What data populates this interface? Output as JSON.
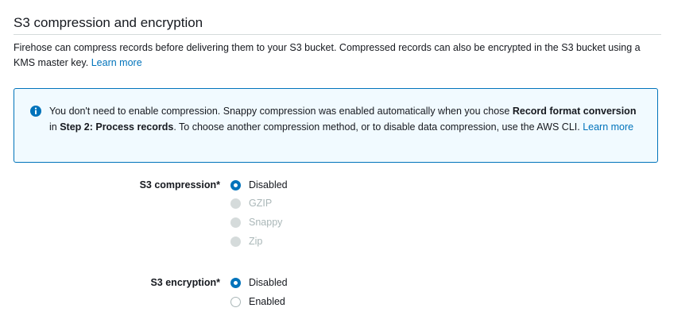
{
  "section": {
    "title": "S3 compression and encryption",
    "description": "Firehose can compress records before delivering them to your S3 bucket. Compressed records can also be encrypted in the S3 bucket using a KMS master key.",
    "learn_more": "Learn more"
  },
  "info": {
    "icon": "info-icon",
    "text_1": "You don't need to enable compression. Snappy compression was enabled automatically when you chose ",
    "bold_1": "Record format conversion",
    "text_2": " in ",
    "bold_2": "Step 2: Process records",
    "text_3": ". To choose another compression method, or to disable data compression, use the AWS CLI. ",
    "learn_more": "Learn more"
  },
  "s3_compression": {
    "label": "S3 compression*",
    "options": [
      {
        "label": "Disabled",
        "selected": true,
        "disabled": false
      },
      {
        "label": "GZIP",
        "selected": false,
        "disabled": true
      },
      {
        "label": "Snappy",
        "selected": false,
        "disabled": true
      },
      {
        "label": "Zip",
        "selected": false,
        "disabled": true
      }
    ]
  },
  "s3_encryption": {
    "label": "S3 encryption*",
    "options": [
      {
        "label": "Disabled",
        "selected": true,
        "disabled": false
      },
      {
        "label": "Enabled",
        "selected": false,
        "disabled": false
      }
    ]
  },
  "colors": {
    "accent": "#0073bb",
    "info_bg": "#f1faff",
    "disabled": "#aab7b8"
  }
}
